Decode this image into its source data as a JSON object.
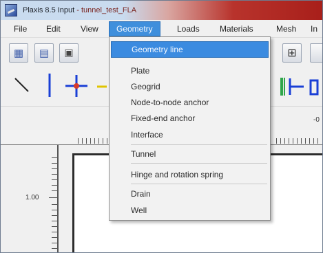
{
  "window": {
    "title_app": "Plaxis 8.5 Input",
    "title_file": " - tunnel_test_FLA"
  },
  "menubar": {
    "items": [
      {
        "label": "File"
      },
      {
        "label": "Edit"
      },
      {
        "label": "View"
      },
      {
        "label": "Geometry",
        "active": true
      },
      {
        "label": "Loads"
      },
      {
        "label": "Materials"
      },
      {
        "label": "Mesh"
      },
      {
        "label": "In"
      }
    ]
  },
  "geometry_menu": {
    "items": [
      {
        "label": "Geometry line",
        "highlighted": true
      },
      {
        "label": "Plate"
      },
      {
        "label": "Geogrid"
      },
      {
        "label": "Node-to-node anchor"
      },
      {
        "label": "Fixed-end anchor"
      },
      {
        "label": "Interface"
      },
      {
        "label": "Tunnel"
      },
      {
        "label": "Hinge and rotation spring"
      },
      {
        "label": "Drain"
      },
      {
        "label": "Well"
      }
    ]
  },
  "toolbar": {
    "buttons": [
      {
        "icon": "new-project-icon"
      },
      {
        "icon": "open-project-icon"
      },
      {
        "icon": "save-project-icon"
      },
      {
        "icon": "material-sets-icon"
      }
    ],
    "tools": [
      {
        "icon": "selection-icon"
      },
      {
        "icon": "geometry-line-icon"
      },
      {
        "icon": "plate-icon"
      },
      {
        "icon": "node-to-node-anchor-icon"
      },
      {
        "icon": "tunnel-icon"
      }
    ]
  },
  "ruler": {
    "left_label": "1.00",
    "top_label": "-0"
  },
  "colors": {
    "menu_highlight": "#3b8be0",
    "title_accent": "#a81f1a"
  }
}
